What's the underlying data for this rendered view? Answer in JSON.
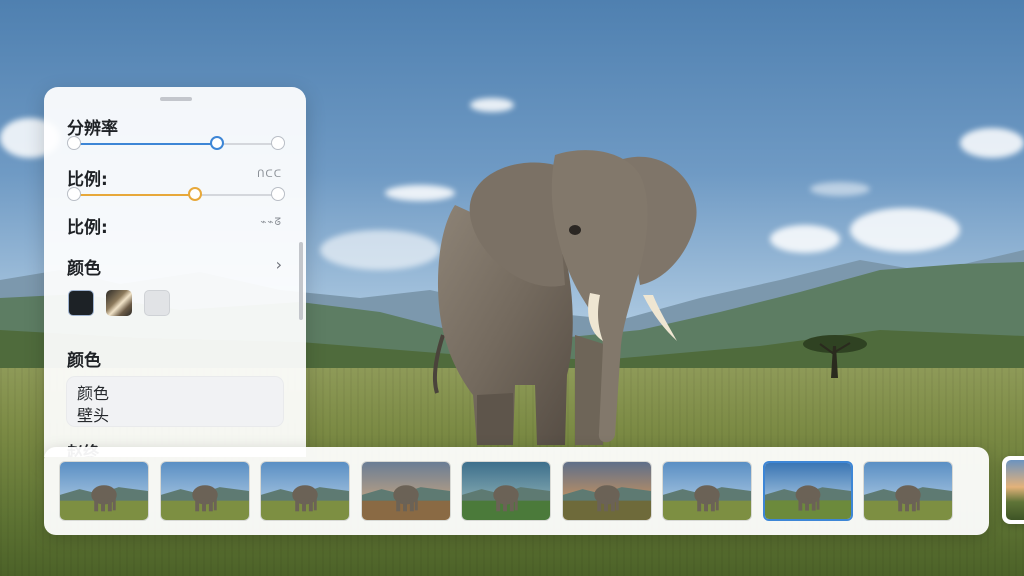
{
  "panel": {
    "resolution_label": "分辨率",
    "resolution_value": 0.7,
    "ratio_label_1": "比例:",
    "ratio_value_text": "ᑎᑕᑕ",
    "ratio_slider_value": 0.59,
    "ratio_label_2": "比例:",
    "ratio_value_text_2": "⌁⌁ᘔ",
    "color_label": "颜色",
    "color_section_label": "颜色",
    "swatches": [
      "#1d2226",
      "#b8a07a",
      "#e1e3e6"
    ],
    "field_line1": "颜色",
    "field_line2": "壁头",
    "cut_label": "赵终"
  },
  "colors": {
    "accent_blue": "#3d86d6",
    "accent_orange": "#e7a83a"
  },
  "thumbnails": [
    {
      "id": "t1",
      "scene": "day"
    },
    {
      "id": "t2",
      "scene": "day"
    },
    {
      "id": "t3",
      "scene": "day"
    },
    {
      "id": "t4",
      "scene": "dusk"
    },
    {
      "id": "t5",
      "scene": "green"
    },
    {
      "id": "t6",
      "scene": "sunset"
    },
    {
      "id": "t7",
      "scene": "day"
    },
    {
      "id": "t8",
      "scene": "selected"
    },
    {
      "id": "t9",
      "scene": "day"
    }
  ],
  "selected_thumbnail": 7
}
